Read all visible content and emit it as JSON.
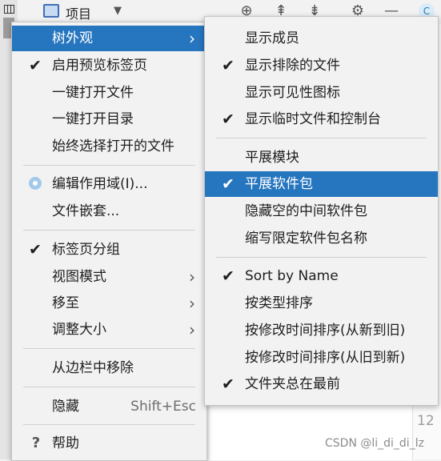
{
  "toolbar": {
    "project_title": "项目",
    "dropdown_icon": "triangle-down",
    "icons": [
      "crosshair-icon",
      "collapse-all-icon",
      "expand-all-icon",
      "gear-icon",
      "minimize-icon"
    ]
  },
  "right_panel": {
    "avatar_letter": "C",
    "line_number": "12"
  },
  "watermark": "CSDN @li_di_di_lz",
  "main_menu": {
    "items": [
      {
        "label": "树外观",
        "check": "",
        "arrow": "›",
        "selected": true
      },
      {
        "label": "启用预览标签页",
        "check": "✔"
      },
      {
        "label": "一键打开文件"
      },
      {
        "label": "一键打开目录"
      },
      {
        "label": "始终选择打开的文件"
      },
      {
        "label": "编辑作用域(I)..."
      },
      {
        "label": "文件嵌套..."
      },
      {
        "label": "标签页分组",
        "check": "✔"
      },
      {
        "label": "视图模式",
        "arrow": "›"
      },
      {
        "label": "移至",
        "arrow": "›"
      },
      {
        "label": "调整大小",
        "arrow": "›"
      },
      {
        "label": "从边栏中移除"
      },
      {
        "label": "隐藏",
        "shortcut": "Shift+Esc"
      },
      {
        "label": "帮助",
        "icon": "?"
      }
    ]
  },
  "sub_menu": {
    "items": [
      {
        "label": "显示成员",
        "check": ""
      },
      {
        "label": "显示排除的文件",
        "check": "✔"
      },
      {
        "label": "显示可见性图标",
        "check": ""
      },
      {
        "label": "显示临时文件和控制台",
        "check": "✔"
      },
      {
        "label": "平展模块",
        "check": ""
      },
      {
        "label": "平展软件包",
        "check": "✔",
        "selected": true
      },
      {
        "label": "隐藏空的中间软件包",
        "check": ""
      },
      {
        "label": "缩写限定软件包名称",
        "check": ""
      },
      {
        "label": "Sort by Name",
        "check": "✔"
      },
      {
        "label": "按类型排序",
        "check": ""
      },
      {
        "label": "按修改时间排序(从新到旧)",
        "check": ""
      },
      {
        "label": "按修改时间排序(从旧到新)",
        "check": ""
      },
      {
        "label": "文件夹总在最前",
        "check": "✔"
      }
    ]
  },
  "colors": {
    "selection": "#2675bf",
    "menu_bg": "#f2f2f2",
    "separator": "#d0d0d0"
  }
}
